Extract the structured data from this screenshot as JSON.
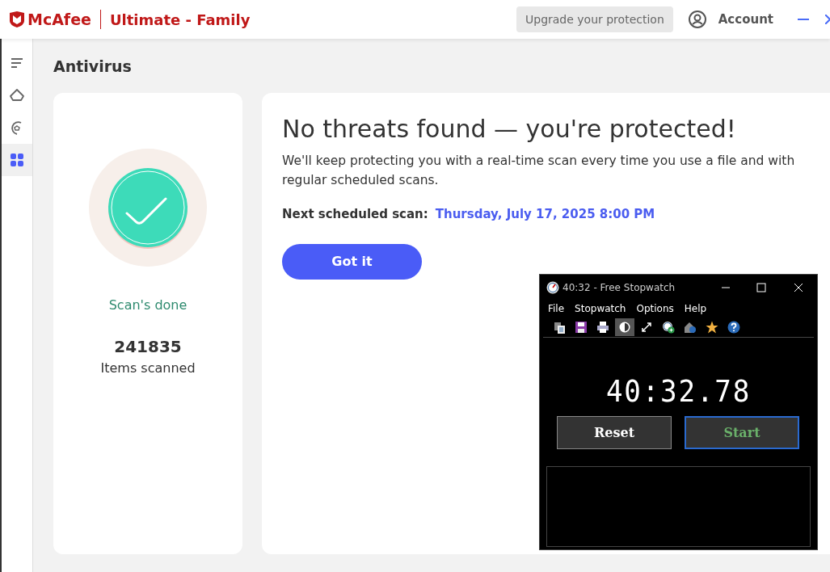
{
  "header": {
    "brand": "McAfee",
    "product": "Ultimate - Family",
    "upgrade_button": "Upgrade your protection",
    "account": "Account"
  },
  "sidebar": {
    "items": [
      {
        "kind": "menu",
        "selected": false
      },
      {
        "kind": "home",
        "selected": false
      },
      {
        "kind": "protection",
        "selected": false
      },
      {
        "kind": "apps",
        "selected": true
      }
    ]
  },
  "page_title": "Antivirus",
  "scan_card": {
    "status": "Scan's done",
    "count": "241835",
    "count_label": "Items scanned"
  },
  "result_card": {
    "heading": "No threats found — you're protected!",
    "message": "We'll keep protecting you with a real-time scan every time you use a file and with regular scheduled scans.",
    "next_scan_label": "Next scheduled scan:",
    "next_scan_value": "Thursday, July 17, 2025 8:00 PM",
    "button": "Got it"
  },
  "stopwatch": {
    "title": "40:32 - Free Stopwatch",
    "menu": [
      "File",
      "Stopwatch",
      "Options",
      "Help"
    ],
    "toolbar": [
      {
        "kind": "copy",
        "pressed": false
      },
      {
        "kind": "save",
        "pressed": false
      },
      {
        "kind": "print",
        "pressed": false
      },
      {
        "kind": "contrast",
        "pressed": true
      },
      {
        "kind": "resize",
        "pressed": false
      },
      {
        "kind": "add-clock",
        "pressed": false
      },
      {
        "kind": "home",
        "pressed": false
      },
      {
        "kind": "star",
        "pressed": false
      },
      {
        "kind": "help",
        "pressed": false
      }
    ],
    "time": "40:32.78",
    "buttons": [
      {
        "label": "Reset",
        "focused": false
      },
      {
        "label": "Start",
        "focused": true
      }
    ]
  }
}
